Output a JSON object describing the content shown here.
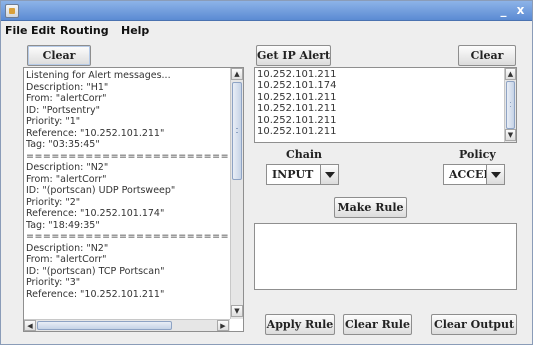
{
  "window": {
    "minimize_glyph": "_",
    "close_glyph": "x"
  },
  "menu": [
    "File",
    "Edit",
    "Routing",
    "Help"
  ],
  "left": {
    "clear_label": "Clear",
    "log_lines": [
      "Listening for Alert messages...",
      "Description: \"H1\"",
      "From: \"alertCorr\"",
      "ID: \"Portsentry\"",
      "Priority: \"1\"",
      "Reference: \"10.252.101.211\"",
      "Tag: \"03:35:45\"",
      "================================",
      "Description: \"N2\"",
      "From: \"alertCorr\"",
      "ID: \"(portscan) UDP Portsweep\"",
      "Priority: \"2\"",
      "Reference: \"10.252.101.174\"",
      "Tag: \"18:49:35\"",
      "================================",
      "Description: \"N2\"",
      "From: \"alertCorr\"",
      "ID: \"(portscan) TCP Portscan\"",
      "Priority: \"3\"",
      "Reference: \"10.252.101.211\""
    ]
  },
  "right": {
    "get_ip_alert_label": "Get IP Alert",
    "clear_label": "Clear",
    "ip_list": [
      "10.252.101.211",
      "10.252.101.174",
      "10.252.101.211",
      "10.252.101.211",
      "10.252.101.211",
      "10.252.101.211"
    ],
    "chain_label": "Chain",
    "policy_label": "Policy",
    "chain_value": "INPUT",
    "policy_value": "ACCEPT",
    "make_rule_label": "Make Rule",
    "output_text": "",
    "apply_rule_label": "Apply Rule",
    "clear_rule_label": "Clear Rule",
    "clear_output_label": "Clear Output"
  }
}
